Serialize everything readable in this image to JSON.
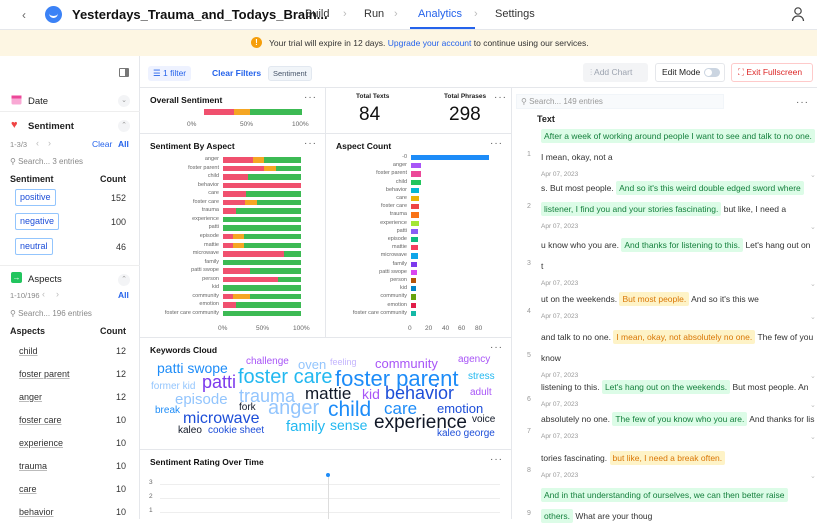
{
  "topbar": {
    "title": "Yesterdays_Trauma_and_Todays_Brain...",
    "back": "‹",
    "nav": [
      "Build",
      "Run",
      "Analytics",
      "Settings"
    ],
    "active_tab": "Analytics"
  },
  "banner": {
    "prefix": "Your trial will expire in 12 days. ",
    "link": "Upgrade your account",
    "suffix": " to continue using our services."
  },
  "filterbar": {
    "filter_count": "1 filter",
    "clear_filters": "Clear Filters",
    "active_filter": "Sentiment",
    "add_chart": "Add Chart",
    "edit_mode": "Edit Mode",
    "exit_fullscreen": "Exit Fullscreen"
  },
  "sidebar": {
    "date_label": "Date",
    "sentiment": {
      "label": "Sentiment",
      "range": "1-3/3",
      "clear": "Clear",
      "all": "All",
      "search_placeholder": "Search... 3 entries",
      "col_name": "Sentiment",
      "col_count": "Count",
      "items": [
        {
          "label": "positive",
          "count": "152"
        },
        {
          "label": "negative",
          "count": "100"
        },
        {
          "label": "neutral",
          "count": "46"
        }
      ]
    },
    "aspects": {
      "label": "Aspects",
      "range": "1-10/196",
      "all": "All",
      "search_placeholder": "Search... 196 entries",
      "col_name": "Aspects",
      "col_count": "Count",
      "items": [
        {
          "label": "child",
          "count": "12"
        },
        {
          "label": "foster parent",
          "count": "12"
        },
        {
          "label": "anger",
          "count": "12"
        },
        {
          "label": "foster care",
          "count": "10"
        },
        {
          "label": "experience",
          "count": "10"
        },
        {
          "label": "trauma",
          "count": "10"
        },
        {
          "label": "care",
          "count": "10"
        },
        {
          "label": "behavior",
          "count": "10"
        }
      ]
    }
  },
  "overall": {
    "title": "Overall Sentiment",
    "ticks": [
      "0%",
      "50%",
      "100%"
    ],
    "negative": 0.31,
    "neutral": 0.16,
    "positive": 0.53
  },
  "totals": {
    "texts_label": "Total Texts",
    "texts_value": "84",
    "phrases_label": "Total Phrases",
    "phrases_value": "298"
  },
  "chart_data": [
    {
      "type": "bar",
      "title": "Sentiment By Aspect",
      "stacked": true,
      "orientation": "horizontal",
      "categories": [
        "anger",
        "foster parent",
        "child",
        "behavior",
        "care",
        "foster care",
        "trauma",
        "experience",
        "patti",
        "episode",
        "mattie",
        "microwave",
        "family",
        "patti swope",
        "person",
        "kid",
        "community",
        "emotion",
        "foster care community"
      ],
      "series": [
        {
          "name": "negative",
          "color": "#f0506e",
          "values": [
            0.38,
            0.52,
            0.32,
            1.0,
            0.3,
            0.28,
            0.17,
            0.0,
            0.0,
            0.13,
            0.13,
            0.78,
            0.0,
            0.34,
            0.71,
            0.0,
            0.13,
            0.17,
            0.0
          ]
        },
        {
          "name": "neutral",
          "color": "#f5a623",
          "values": [
            0.14,
            0.16,
            0.0,
            0.0,
            0.0,
            0.15,
            0.0,
            0.0,
            0.0,
            0.14,
            0.14,
            0.0,
            0.0,
            0.0,
            0.0,
            0.0,
            0.22,
            0.0,
            0.0
          ]
        },
        {
          "name": "positive",
          "color": "#3cba54",
          "values": [
            0.48,
            0.32,
            0.68,
            0.0,
            0.7,
            0.57,
            0.83,
            1.0,
            1.0,
            0.73,
            0.73,
            0.22,
            1.0,
            0.66,
            0.29,
            1.0,
            0.65,
            0.83,
            1.0
          ]
        }
      ],
      "ticks": [
        "0%",
        "50%",
        "100%"
      ]
    },
    {
      "type": "bar",
      "title": "Aspect Count",
      "orientation": "horizontal",
      "categories": [
        "-0",
        "anger",
        "foster parent",
        "child",
        "behavior",
        "care",
        "foster care",
        "trauma",
        "experience",
        "patti",
        "episode",
        "mattie",
        "microwave",
        "family",
        "patti swope",
        "person",
        "kid",
        "community",
        "emotion",
        "foster care community"
      ],
      "values": [
        95,
        12,
        12,
        12,
        10,
        10,
        10,
        10,
        10,
        9,
        9,
        8,
        8,
        7,
        7,
        6,
        6,
        6,
        6,
        6
      ],
      "colors": [
        "#1d8cf8",
        "#a855f7",
        "#ec4899",
        "#22c55e",
        "#06b6d4",
        "#eab308",
        "#ef4444",
        "#f97316",
        "#a3e635",
        "#8b5cf6",
        "#10b981",
        "#f43f5e",
        "#0ea5e9",
        "#7c3aed",
        "#d946ef",
        "#b45309",
        "#0284c7",
        "#65a30d",
        "#e11d48",
        "#14b8a6"
      ],
      "ticks": [
        "0",
        "20",
        "40",
        "60",
        "80"
      ],
      "xlim": [
        0,
        95
      ]
    },
    {
      "type": "line",
      "title": "Sentiment Rating Over Time",
      "y_ticks": [
        "3",
        "2",
        "1"
      ]
    }
  ],
  "cloud": {
    "title": "Keywords Cloud",
    "words": [
      {
        "t": "patti swope",
        "x": 157,
        "y": 361,
        "s": 14,
        "c": "#1d8cf8"
      },
      {
        "t": "challenge",
        "x": 246,
        "y": 357,
        "s": 10,
        "c": "#a855f7"
      },
      {
        "t": "oven",
        "x": 298,
        "y": 358,
        "s": 13,
        "c": "#93c5fd"
      },
      {
        "t": "feeling",
        "x": 330,
        "y": 358,
        "s": 9,
        "c": "#c4b5fd"
      },
      {
        "t": "community",
        "x": 375,
        "y": 357,
        "s": 13,
        "c": "#a855f7"
      },
      {
        "t": "agency",
        "x": 458,
        "y": 355,
        "s": 10,
        "c": "#a855f7"
      },
      {
        "t": "former kid",
        "x": 151,
        "y": 382,
        "s": 10,
        "c": "#93c5fd"
      },
      {
        "t": "patti",
        "x": 202,
        "y": 373,
        "s": 18,
        "c": "#7c3aed"
      },
      {
        "t": "foster care",
        "x": 238,
        "y": 367,
        "s": 20,
        "c": "#22b8f0"
      },
      {
        "t": "foster parent",
        "x": 335,
        "y": 368,
        "s": 22,
        "c": "#1d8cf8"
      },
      {
        "t": "stress",
        "x": 468,
        "y": 372,
        "s": 10,
        "c": "#22b8f0"
      },
      {
        "t": "episode",
        "x": 175,
        "y": 392,
        "s": 15,
        "c": "#93c5fd"
      },
      {
        "t": "trauma",
        "x": 239,
        "y": 387,
        "s": 18,
        "c": "#93c5fd"
      },
      {
        "t": "mattie",
        "x": 305,
        "y": 385,
        "s": 17,
        "c": "#111827"
      },
      {
        "t": "kid",
        "x": 362,
        "y": 387,
        "s": 14,
        "c": "#a855f7"
      },
      {
        "t": "behavior",
        "x": 385,
        "y": 384,
        "s": 18,
        "c": "#1d4ed8"
      },
      {
        "t": "adult",
        "x": 470,
        "y": 388,
        "s": 10,
        "c": "#a855f7"
      },
      {
        "t": "break",
        "x": 155,
        "y": 406,
        "s": 10,
        "c": "#1d8cf8"
      },
      {
        "t": "fork",
        "x": 239,
        "y": 403,
        "s": 10,
        "c": "#111827"
      },
      {
        "t": "anger",
        "x": 268,
        "y": 398,
        "s": 20,
        "c": "#93c5fd"
      },
      {
        "t": "child",
        "x": 328,
        "y": 399,
        "s": 21,
        "c": "#1d8cf8"
      },
      {
        "t": "care",
        "x": 384,
        "y": 400,
        "s": 17,
        "c": "#1d8cf8"
      },
      {
        "t": "emotion",
        "x": 437,
        "y": 402,
        "s": 13,
        "c": "#1d4ed8"
      },
      {
        "t": "microwave",
        "x": 183,
        "y": 411,
        "s": 16,
        "c": "#1d4ed8"
      },
      {
        "t": "family",
        "x": 286,
        "y": 419,
        "s": 15,
        "c": "#22b8f0"
      },
      {
        "t": "sense",
        "x": 330,
        "y": 418,
        "s": 14,
        "c": "#22b8f0"
      },
      {
        "t": "experience",
        "x": 374,
        "y": 413,
        "s": 19,
        "c": "#111827"
      },
      {
        "t": "voice",
        "x": 472,
        "y": 415,
        "s": 10,
        "c": "#111827"
      },
      {
        "t": "kaleo",
        "x": 178,
        "y": 426,
        "s": 10,
        "c": "#111827"
      },
      {
        "t": "cookie sheet",
        "x": 208,
        "y": 426,
        "s": 10,
        "c": "#1d4ed8"
      },
      {
        "t": "kaleo george",
        "x": 437,
        "y": 429,
        "s": 10,
        "c": "#1d4ed8"
      }
    ]
  },
  "textpanel": {
    "search_placeholder": "Search... 149 entries",
    "col": "Text",
    "entries": [
      {
        "num": "1",
        "segs": [
          {
            "t": "After a week of working around people I want to see and talk to no one.",
            "h": "g"
          }
        ],
        "line2": [
          {
            "t": "I mean, okay, not a",
            "h": ""
          }
        ],
        "date": "Apr 07, 2023"
      },
      {
        "num": "2",
        "segs": [
          {
            "t": "s. But most people. ",
            "h": ""
          },
          {
            "t": "And so it's this weird double edged sword where",
            "h": "g"
          }
        ],
        "line2": [
          {
            "t": "listener, I find you and your stories fascinating.",
            "h": "g"
          },
          {
            "t": "  but like, I need a",
            "h": ""
          }
        ],
        "date": "Apr 07, 2023"
      },
      {
        "num": "3",
        "segs": [
          {
            "t": "u know who you are. ",
            "h": ""
          },
          {
            "t": "And thanks for listening to this.",
            "h": "g"
          },
          {
            "t": "  Let's hang out on",
            "h": ""
          }
        ],
        "line2": [
          {
            "t": "t",
            "h": ""
          }
        ],
        "date": "Apr 07, 2023"
      },
      {
        "num": "4",
        "segs": [
          {
            "t": "ut on the weekends. ",
            "h": ""
          },
          {
            "t": "But most people.",
            "h": "o"
          },
          {
            "t": "  And so it's this we",
            "h": ""
          }
        ],
        "line2": [],
        "date": "Apr 07, 2023"
      },
      {
        "num": "5",
        "segs": [
          {
            "t": "and talk to no one. ",
            "h": ""
          },
          {
            "t": "I mean, okay, not absolutely no one.",
            "h": "o"
          },
          {
            "t": "  The few of you",
            "h": ""
          }
        ],
        "line2": [
          {
            "t": "know",
            "h": ""
          }
        ],
        "date": "Apr 07, 2023"
      },
      {
        "num": "6",
        "segs": [
          {
            "t": "listening to this. ",
            "h": ""
          },
          {
            "t": "Let's hang out on the weekends.",
            "h": "g"
          },
          {
            "t": "  But most people. An",
            "h": ""
          }
        ],
        "line2": [],
        "date": "Apr 07, 2023"
      },
      {
        "num": "7",
        "segs": [
          {
            "t": "absolutely no one. ",
            "h": ""
          },
          {
            "t": "The few of you know who you are.",
            "h": "g"
          },
          {
            "t": "  And thanks for lis",
            "h": ""
          }
        ],
        "line2": [],
        "date": "Apr 07, 2023"
      },
      {
        "num": "8",
        "segs": [
          {
            "t": "tories fascinating. ",
            "h": ""
          },
          {
            "t": "but like, I need a break often.",
            "h": "o"
          }
        ],
        "line2": [],
        "date": "Apr 07, 2023"
      },
      {
        "num": "9",
        "segs": [
          {
            "t": "And in that understanding of ourselves, we can then better raise",
            "h": "g"
          }
        ],
        "line2": [
          {
            "t": "others.",
            "h": "g"
          },
          {
            "t": "  What are your thoug",
            "h": ""
          }
        ],
        "date": ""
      }
    ]
  }
}
